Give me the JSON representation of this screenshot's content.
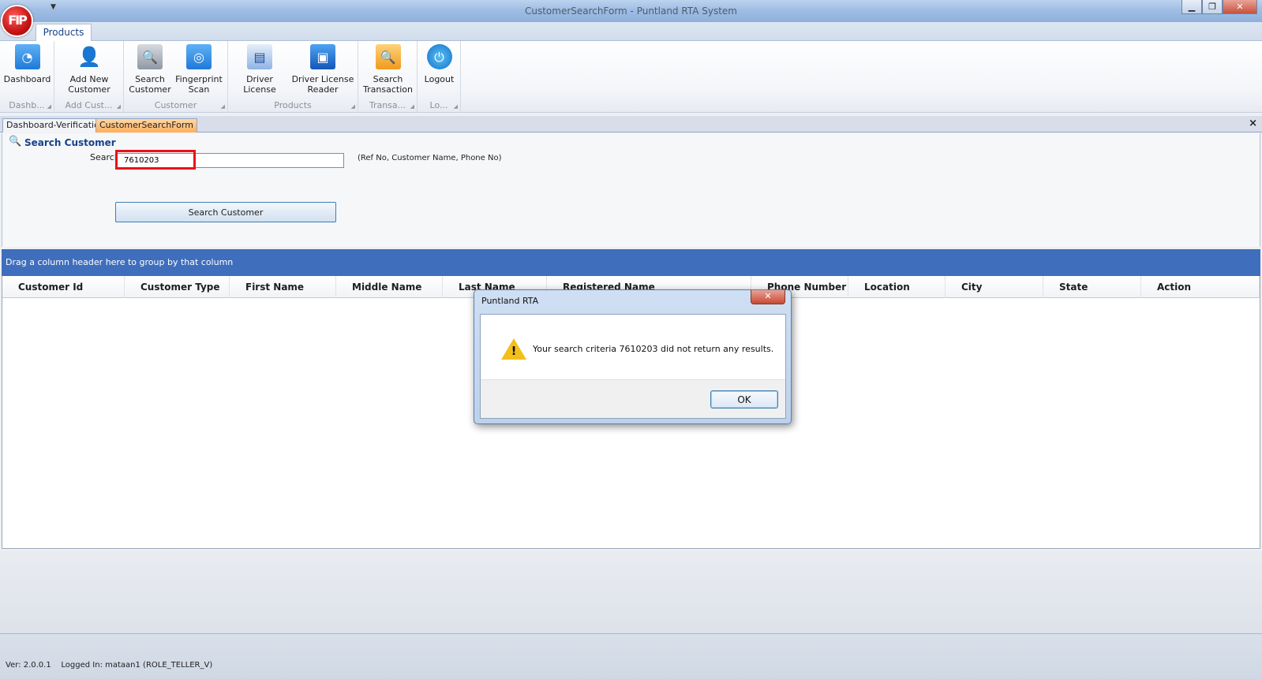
{
  "window": {
    "title": "CustomerSearchForm - Puntland RTA System",
    "logo_text": "FIP",
    "controls": {
      "minimize": "▁",
      "restore": "❐",
      "close": "✕"
    }
  },
  "ribbon": {
    "tab": "Products",
    "groups": [
      {
        "label": "Dashb...",
        "buttons": [
          {
            "label": "Dashboard",
            "icon": "dashboard-icon"
          }
        ]
      },
      {
        "label": "Add Cust...",
        "buttons": [
          {
            "label": "Add New Customer",
            "icon": "add-user-icon"
          }
        ]
      },
      {
        "label": "Customer",
        "buttons": [
          {
            "label": "Search Customer",
            "icon": "search-customer-icon"
          },
          {
            "label": "Fingerprint Scan",
            "icon": "fingerprint-icon"
          }
        ]
      },
      {
        "label": "Products",
        "buttons": [
          {
            "label": "Driver License",
            "icon": "license-card-icon"
          },
          {
            "label": "Driver License Reader",
            "icon": "card-reader-icon"
          }
        ]
      },
      {
        "label": "Transa...",
        "buttons": [
          {
            "label": "Search Transaction",
            "icon": "search-transaction-icon"
          }
        ]
      },
      {
        "label": "Lo...",
        "buttons": [
          {
            "label": "Logout",
            "icon": "logout-icon"
          }
        ]
      }
    ]
  },
  "doc_tabs": [
    "Dashboard-Verification",
    "CustomerSearchForm"
  ],
  "doc_close": "×",
  "form": {
    "title": "Search Customer",
    "search_label": "Search",
    "search_value": "7610203",
    "hint": "(Ref No, Customer Name, Phone No)",
    "search_button": "Search Customer"
  },
  "grid": {
    "group_hint": "Drag a column header here to group by that column",
    "columns": [
      "Customer Id",
      "Customer Type",
      "First Name",
      "Middle Name",
      "Last Name",
      "Registered Name",
      "Phone Number",
      "Location",
      "City",
      "State",
      "Action"
    ]
  },
  "status": {
    "text": "Ver: 2.0.0.1    Logged In: mataan1 (ROLE_TELLER_V)"
  },
  "dialog": {
    "title": "Puntland RTA",
    "message": "Your search criteria 7610203 did not return any results.",
    "ok": "OK",
    "icon": "warning-icon"
  }
}
